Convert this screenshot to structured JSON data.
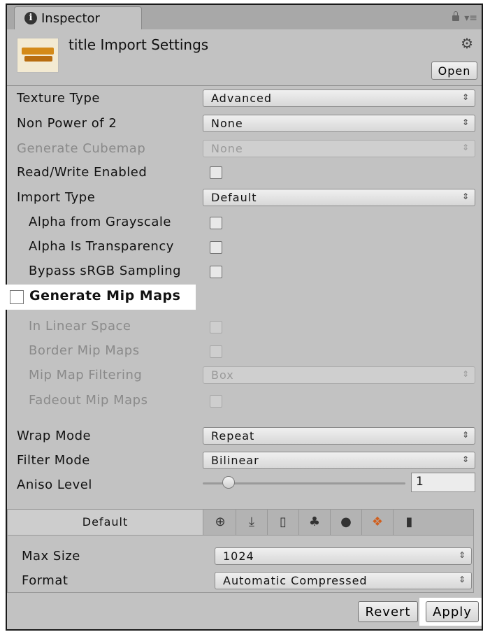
{
  "tab": {
    "label": "Inspector"
  },
  "header": {
    "title": "title Import Settings",
    "open_label": "Open"
  },
  "fields": {
    "texture_type": {
      "label": "Texture Type",
      "value": "Advanced"
    },
    "non_power_of_2": {
      "label": "Non Power of 2",
      "value": "None"
    },
    "generate_cubemap": {
      "label": "Generate Cubemap",
      "value": "None"
    },
    "read_write": {
      "label": "Read/Write Enabled"
    },
    "import_type": {
      "label": "Import Type",
      "value": "Default"
    },
    "alpha_from_grayscale": {
      "label": "Alpha from Grayscale"
    },
    "alpha_is_transparency": {
      "label": "Alpha Is Transparency"
    },
    "bypass_srgb": {
      "label": "Bypass sRGB Sampling"
    },
    "generate_mip_maps": {
      "label": "Generate Mip Maps"
    },
    "in_linear_space": {
      "label": "In Linear Space"
    },
    "border_mip_maps": {
      "label": "Border Mip Maps"
    },
    "mip_map_filtering": {
      "label": "Mip Map Filtering",
      "value": "Box"
    },
    "fadeout_mip_maps": {
      "label": "Fadeout Mip Maps"
    },
    "wrap_mode": {
      "label": "Wrap Mode",
      "value": "Repeat"
    },
    "filter_mode": {
      "label": "Filter Mode",
      "value": "Bilinear"
    },
    "aniso_level": {
      "label": "Aniso Level",
      "value": "1"
    }
  },
  "platform": {
    "default_tab": "Default",
    "icons": [
      "web-icon",
      "standalone-download-icon",
      "ios-phone-icon",
      "android-icon",
      "blackberry-icon",
      "windows-store-icon",
      "windows-phone-icon"
    ],
    "max_size": {
      "label": "Max Size",
      "value": "1024"
    },
    "format": {
      "label": "Format",
      "value": "Automatic Compressed"
    }
  },
  "footer": {
    "revert_label": "Revert",
    "apply_label": "Apply"
  }
}
